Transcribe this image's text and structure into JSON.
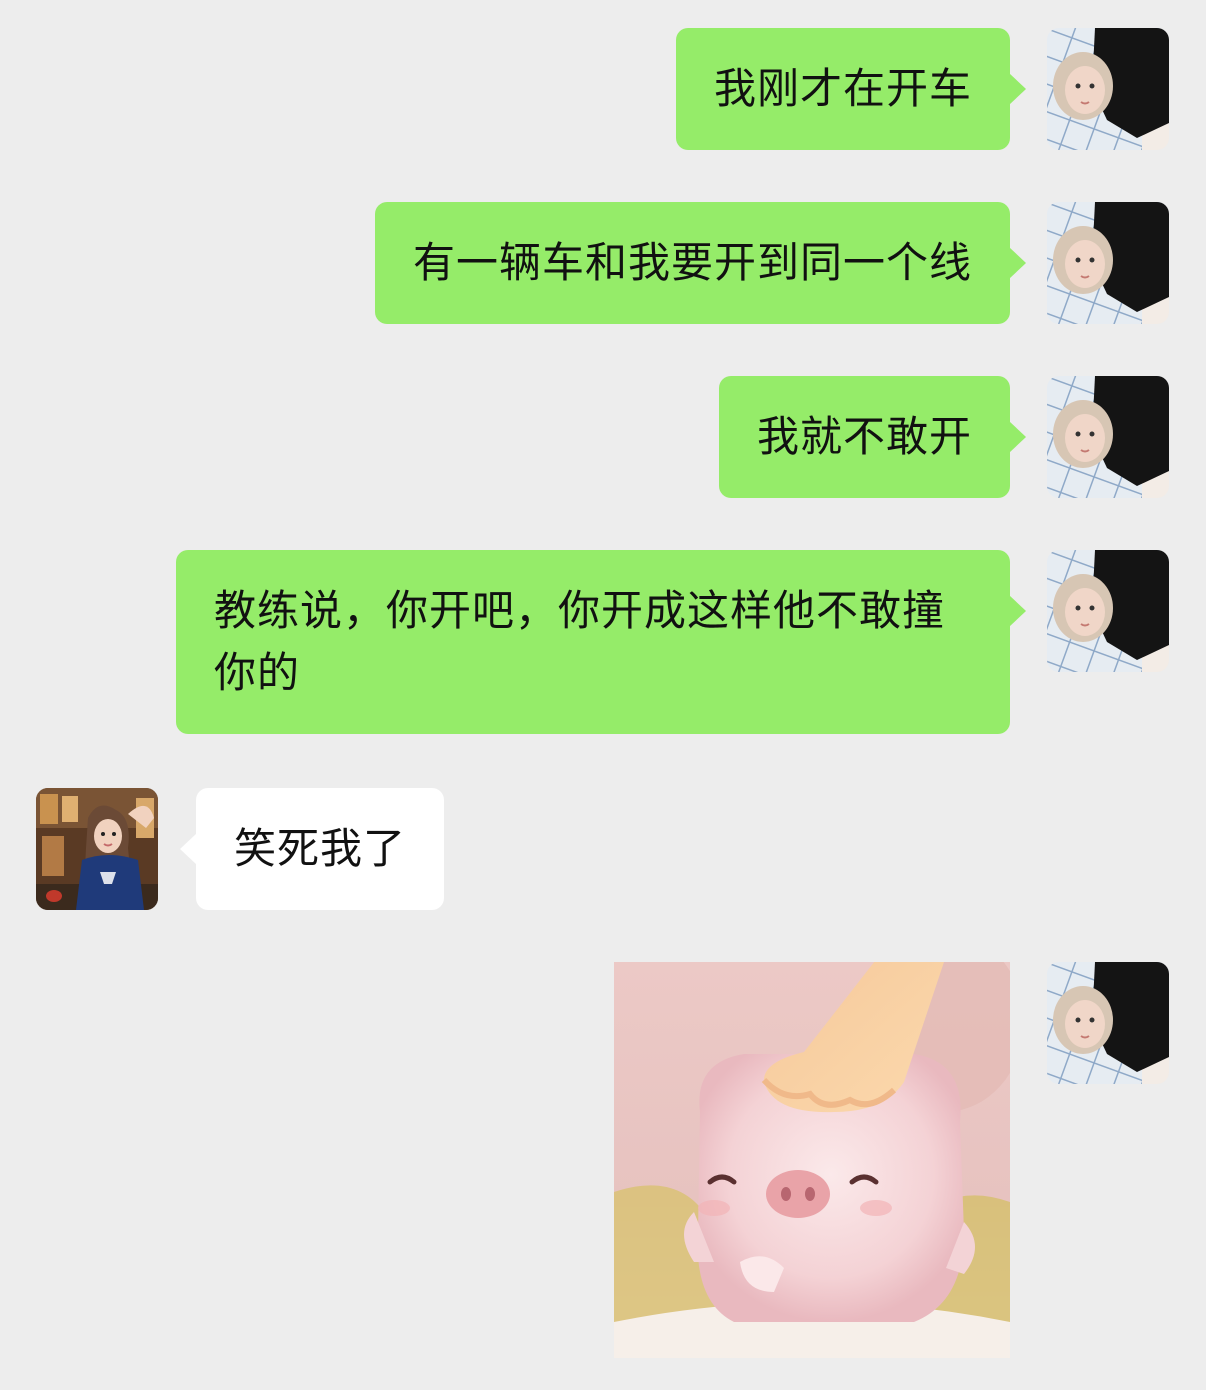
{
  "chat": {
    "messages": [
      {
        "side": "sent",
        "text": "我刚才在开车"
      },
      {
        "side": "sent",
        "text": "有一辆车和我要开到同一个线"
      },
      {
        "side": "sent",
        "text": "我就不敢开"
      },
      {
        "side": "sent",
        "text": "教练说，你开吧，你开成这样他不敢撞你的"
      },
      {
        "side": "received",
        "text": "笑死我了"
      },
      {
        "side": "sent",
        "type": "sticker",
        "sticker": "pig-being-patted-sticker"
      }
    ]
  },
  "colors": {
    "background": "#ededed",
    "sent_bubble": "#95ec69",
    "received_bubble": "#ffffff",
    "text": "#111111"
  },
  "icons": {
    "self_avatar": "avatar-girl-with-black-cat",
    "contact_avatar": "avatar-woman-in-blue-tshirt"
  }
}
